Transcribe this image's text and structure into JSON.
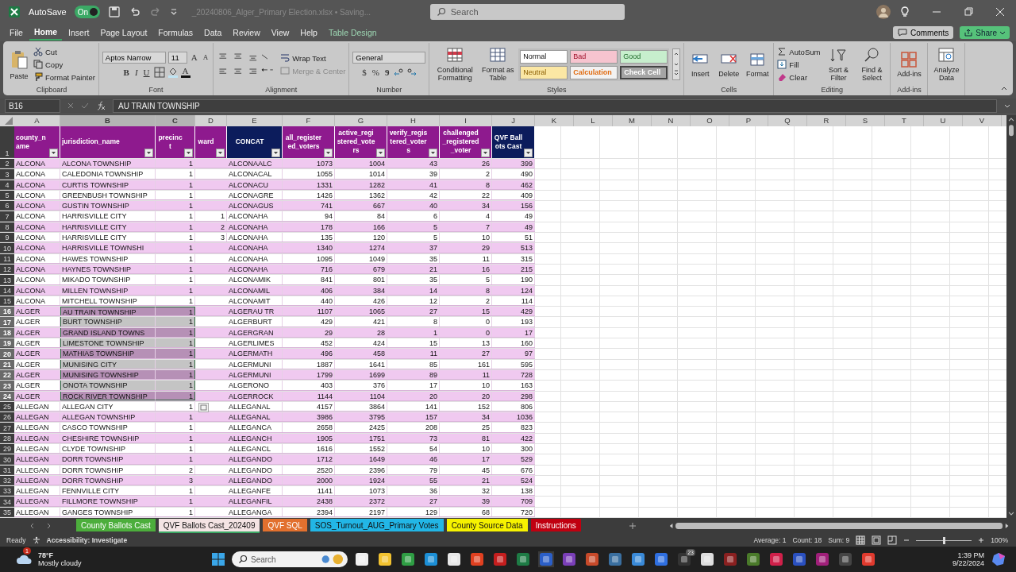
{
  "title_bar": {
    "autosave_label": "AutoSave",
    "autosave_toggle": {
      "label": "On",
      "on": true
    },
    "filename": "_20240806_Alger_Primary Election.xlsx • Saving...",
    "search_placeholder": "Search"
  },
  "menu_tabs": [
    {
      "label": "File",
      "selected": false,
      "kind": "standard"
    },
    {
      "label": "Home",
      "selected": true,
      "kind": "standard"
    },
    {
      "label": "Insert",
      "selected": false,
      "kind": "standard"
    },
    {
      "label": "Page Layout",
      "selected": false,
      "kind": "standard"
    },
    {
      "label": "Formulas",
      "selected": false,
      "kind": "standard"
    },
    {
      "label": "Data",
      "selected": false,
      "kind": "standard"
    },
    {
      "label": "Review",
      "selected": false,
      "kind": "standard"
    },
    {
      "label": "View",
      "selected": false,
      "kind": "standard"
    },
    {
      "label": "Help",
      "selected": false,
      "kind": "standard"
    },
    {
      "label": "Table Design",
      "selected": false,
      "kind": "contextual"
    }
  ],
  "comments_button": "Comments",
  "share_button": "Share",
  "ribbon": {
    "clipboard": {
      "label": "Clipboard",
      "paste": "Paste",
      "cut": "Cut",
      "copy": "Copy",
      "format_painter": "Format Painter"
    },
    "font": {
      "label": "Font",
      "font_name": "Aptos Narrow",
      "font_size": "11",
      "grow": "A",
      "shrink": "A",
      "bold": "B",
      "italic": "I",
      "underline": "U",
      "font_color": "A"
    },
    "alignment": {
      "label": "Alignment",
      "wrap_text": "Wrap Text",
      "merge_center": {
        "label": "Merge & Center",
        "disabled": true
      }
    },
    "number": {
      "label": "Number",
      "format": "General",
      "currency": "$",
      "percent": "%",
      "comma": "9"
    },
    "styles": {
      "label": "Styles",
      "conditional_formatting": "Conditional Formatting",
      "format_as_table": "Format as Table",
      "cell_styles": [
        {
          "label": "Normal",
          "kind": "normal"
        },
        {
          "label": "Bad",
          "kind": "bad"
        },
        {
          "label": "Good",
          "kind": "good"
        },
        {
          "label": "Neutral",
          "kind": "neutral"
        },
        {
          "label": "Calculation",
          "kind": "calculation"
        },
        {
          "label": "Check Cell",
          "kind": "check"
        }
      ]
    },
    "cells": {
      "label": "Cells",
      "insert": "Insert",
      "delete": "Delete",
      "format": "Format"
    },
    "editing": {
      "label": "Editing",
      "autosum": "AutoSum",
      "fill": "Fill",
      "clear": "Clear",
      "sort_filter": "Sort & Filter",
      "find_select": "Find & Select"
    },
    "addins": {
      "label": "Add-ins",
      "addins": "Add-ins"
    },
    "analyze_data": "Analyze Data"
  },
  "formula_bar": {
    "name_box": "B16",
    "formula": "AU TRAIN TOWNSHIP"
  },
  "column_letters": [
    {
      "label": "A",
      "selected": false
    },
    {
      "label": "B",
      "selected": true
    },
    {
      "label": "C",
      "selected": true
    },
    {
      "label": "D",
      "selected": false
    },
    {
      "label": "E",
      "selected": false
    },
    {
      "label": "F",
      "selected": false
    },
    {
      "label": "G",
      "selected": false
    },
    {
      "label": "H",
      "selected": false
    },
    {
      "label": "I",
      "selected": false
    },
    {
      "label": "J",
      "selected": false
    },
    {
      "label": "K",
      "selected": false
    },
    {
      "label": "L",
      "selected": false
    },
    {
      "label": "M",
      "selected": false
    },
    {
      "label": "N",
      "selected": false
    },
    {
      "label": "O",
      "selected": false
    },
    {
      "label": "P",
      "selected": false
    },
    {
      "label": "Q",
      "selected": false
    },
    {
      "label": "R",
      "selected": false
    },
    {
      "label": "S",
      "selected": false
    },
    {
      "label": "T",
      "selected": false
    },
    {
      "label": "U",
      "selected": false
    },
    {
      "label": "V",
      "selected": false
    }
  ],
  "table": {
    "header_row_number": "1",
    "columns": [
      {
        "label": "county_name",
        "color": "#8e1a8e"
      },
      {
        "label": "jurisdiction_name",
        "color": "#8e1a8e"
      },
      {
        "label": "precinct",
        "color": "#8e1a8e"
      },
      {
        "label": "ward",
        "color": "#8e1a8e"
      },
      {
        "label": "CONCAT",
        "color": "#0c1c5c"
      },
      {
        "label": "all_registered_voters",
        "color": "#8e1a8e"
      },
      {
        "label": "active_registered_voters",
        "color": "#8e1a8e"
      },
      {
        "label": "verify_registered_voters",
        "color": "#8e1a8e"
      },
      {
        "label": "challenged_registered_voter",
        "color": "#8e1a8e"
      },
      {
        "label": "QVF Ballots Cast",
        "color": "#0c1c5c"
      }
    ],
    "rows": [
      {
        "n": "2",
        "selected": false,
        "cells": [
          "ALCONA",
          "ALCONA TOWNSHIP",
          "1",
          null,
          "ALCONAALC",
          "1073",
          "1004",
          "43",
          "26",
          "399"
        ]
      },
      {
        "n": "3",
        "selected": false,
        "cells": [
          "ALCONA",
          "CALEDONIA TOWNSHIP",
          "1",
          null,
          "ALCONACAL",
          "1055",
          "1014",
          "39",
          "2",
          "490"
        ]
      },
      {
        "n": "4",
        "selected": false,
        "cells": [
          "ALCONA",
          "CURTIS TOWNSHIP",
          "1",
          null,
          "ALCONACU",
          "1331",
          "1282",
          "41",
          "8",
          "462"
        ]
      },
      {
        "n": "5",
        "selected": false,
        "cells": [
          "ALCONA",
          "GREENBUSH TOWNSHIP",
          "1",
          null,
          "ALCONAGRE",
          "1426",
          "1362",
          "42",
          "22",
          "409"
        ]
      },
      {
        "n": "6",
        "selected": false,
        "cells": [
          "ALCONA",
          "GUSTIN TOWNSHIP",
          "1",
          null,
          "ALCONAGUS",
          "741",
          "667",
          "40",
          "34",
          "156"
        ]
      },
      {
        "n": "7",
        "selected": false,
        "cells": [
          "ALCONA",
          "HARRISVILLE CITY",
          "1",
          "1",
          "ALCONAHA",
          "94",
          "84",
          "6",
          "4",
          "49"
        ]
      },
      {
        "n": "8",
        "selected": false,
        "cells": [
          "ALCONA",
          "HARRISVILLE CITY",
          "1",
          "2",
          "ALCONAHA",
          "178",
          "166",
          "5",
          "7",
          "49"
        ]
      },
      {
        "n": "9",
        "selected": false,
        "cells": [
          "ALCONA",
          "HARRISVILLE CITY",
          "1",
          "3",
          "ALCONAHA",
          "135",
          "120",
          "5",
          "10",
          "51"
        ]
      },
      {
        "n": "10",
        "selected": false,
        "cells": [
          "ALCONA",
          "HARRISVILLE TOWNSHI",
          "1",
          null,
          "ALCONAHA",
          "1340",
          "1274",
          "37",
          "29",
          "513"
        ]
      },
      {
        "n": "11",
        "selected": false,
        "cells": [
          "ALCONA",
          "HAWES TOWNSHIP",
          "1",
          null,
          "ALCONAHA",
          "1095",
          "1049",
          "35",
          "11",
          "315"
        ]
      },
      {
        "n": "12",
        "selected": false,
        "cells": [
          "ALCONA",
          "HAYNES TOWNSHIP",
          "1",
          null,
          "ALCONAHA",
          "716",
          "679",
          "21",
          "16",
          "215"
        ]
      },
      {
        "n": "13",
        "selected": false,
        "cells": [
          "ALCONA",
          "MIKADO TOWNSHIP",
          "1",
          null,
          "ALCONAMIK",
          "841",
          "801",
          "35",
          "5",
          "190"
        ]
      },
      {
        "n": "14",
        "selected": false,
        "cells": [
          "ALCONA",
          "MILLEN TOWNSHIP",
          "1",
          null,
          "ALCONAMIL",
          "406",
          "384",
          "14",
          "8",
          "124"
        ]
      },
      {
        "n": "15",
        "selected": false,
        "cells": [
          "ALCONA",
          "MITCHELL TOWNSHIP",
          "1",
          null,
          "ALCONAMIT",
          "440",
          "426",
          "12",
          "2",
          "114"
        ]
      },
      {
        "n": "16",
        "selected": true,
        "cells": [
          "ALGER",
          "AU TRAIN TOWNSHIP",
          "1",
          null,
          "ALGERAU TR",
          "1107",
          "1065",
          "27",
          "15",
          "429"
        ]
      },
      {
        "n": "17",
        "selected": true,
        "cells": [
          "ALGER",
          "BURT TOWNSHIP",
          "1",
          null,
          "ALGERBURT",
          "429",
          "421",
          "8",
          "0",
          "193"
        ]
      },
      {
        "n": "18",
        "selected": true,
        "cells": [
          "ALGER",
          "GRAND ISLAND TOWNS",
          "1",
          null,
          "ALGERGRAN",
          "29",
          "28",
          "1",
          "0",
          "17"
        ]
      },
      {
        "n": "19",
        "selected": true,
        "cells": [
          "ALGER",
          "LIMESTONE TOWNSHIP",
          "1",
          null,
          "ALGERLIMES",
          "452",
          "424",
          "15",
          "13",
          "160"
        ]
      },
      {
        "n": "20",
        "selected": true,
        "cells": [
          "ALGER",
          "MATHIAS TOWNSHIP",
          "1",
          null,
          "ALGERMATH",
          "496",
          "458",
          "11",
          "27",
          "97"
        ]
      },
      {
        "n": "21",
        "selected": true,
        "cells": [
          "ALGER",
          "MUNISING CITY",
          "1",
          null,
          "ALGERMUNI",
          "1887",
          "1641",
          "85",
          "161",
          "595"
        ]
      },
      {
        "n": "22",
        "selected": true,
        "cells": [
          "ALGER",
          "MUNISING TOWNSHIP",
          "1",
          null,
          "ALGERMUNI",
          "1799",
          "1699",
          "89",
          "11",
          "728"
        ]
      },
      {
        "n": "23",
        "selected": true,
        "cells": [
          "ALGER",
          "ONOTA TOWNSHIP",
          "1",
          null,
          "ALGERONO",
          "403",
          "376",
          "17",
          "10",
          "163"
        ]
      },
      {
        "n": "24",
        "selected": true,
        "cells": [
          "ALGER",
          "ROCK RIVER TOWNSHIP",
          "1",
          null,
          "ALGERROCK",
          "1144",
          "1104",
          "20",
          "20",
          "298"
        ]
      },
      {
        "n": "25",
        "selected": false,
        "cells": [
          "ALLEGAN",
          "ALLEGAN CITY",
          "1",
          null,
          "ALLEGANAL",
          "4157",
          "3864",
          "141",
          "152",
          "806"
        ]
      },
      {
        "n": "26",
        "selected": false,
        "cells": [
          "ALLEGAN",
          "ALLEGAN TOWNSHIP",
          "1",
          null,
          "ALLEGANAL",
          "3986",
          "3795",
          "157",
          "34",
          "1036"
        ]
      },
      {
        "n": "27",
        "selected": false,
        "cells": [
          "ALLEGAN",
          "CASCO TOWNSHIP",
          "1",
          null,
          "ALLEGANCA",
          "2658",
          "2425",
          "208",
          "25",
          "823"
        ]
      },
      {
        "n": "28",
        "selected": false,
        "cells": [
          "ALLEGAN",
          "CHESHIRE TOWNSHIP",
          "1",
          null,
          "ALLEGANCH",
          "1905",
          "1751",
          "73",
          "81",
          "422"
        ]
      },
      {
        "n": "29",
        "selected": false,
        "cells": [
          "ALLEGAN",
          "CLYDE TOWNSHIP",
          "1",
          null,
          "ALLEGANCL",
          "1616",
          "1552",
          "54",
          "10",
          "300"
        ]
      },
      {
        "n": "30",
        "selected": false,
        "cells": [
          "ALLEGAN",
          "DORR TOWNSHIP",
          "1",
          null,
          "ALLEGANDO",
          "1712",
          "1649",
          "46",
          "17",
          "529"
        ]
      },
      {
        "n": "31",
        "selected": false,
        "cells": [
          "ALLEGAN",
          "DORR TOWNSHIP",
          "2",
          null,
          "ALLEGANDO",
          "2520",
          "2396",
          "79",
          "45",
          "676"
        ]
      },
      {
        "n": "32",
        "selected": false,
        "cells": [
          "ALLEGAN",
          "DORR TOWNSHIP",
          "3",
          null,
          "ALLEGANDO",
          "2000",
          "1924",
          "55",
          "21",
          "524"
        ]
      },
      {
        "n": "33",
        "selected": false,
        "cells": [
          "ALLEGAN",
          "FENNVILLE CITY",
          "1",
          null,
          "ALLEGANFE",
          "1141",
          "1073",
          "36",
          "32",
          "138"
        ]
      },
      {
        "n": "34",
        "selected": false,
        "cells": [
          "ALLEGAN",
          "FILLMORE TOWNSHIP",
          "1",
          null,
          "ALLEGANFIL",
          "2438",
          "2372",
          "27",
          "39",
          "709"
        ]
      },
      {
        "n": "35",
        "selected": false,
        "cells": [
          "ALLEGAN",
          "GANGES TOWNSHIP",
          "1",
          null,
          "ALLEGANGA",
          "2394",
          "2197",
          "129",
          "68",
          "720"
        ]
      }
    ]
  },
  "sheet_tabs": [
    {
      "label": "County Ballots Cast",
      "color": "#4cae3c",
      "selected": false
    },
    {
      "label": "QVF Ballots Cast_202409",
      "color": "#f4e4e4",
      "selected": true
    },
    {
      "label": "QVF SQL",
      "color": "#e2702e",
      "selected": false
    },
    {
      "label": "SOS_Turnout_AUG_Primary Votes",
      "color": "#22b6e6",
      "selected": false
    },
    {
      "label": "County Source Data",
      "color": "#f6f200",
      "selected": false
    },
    {
      "label": "Instructions",
      "color": "#c00010",
      "selected": false
    }
  ],
  "status_bar": {
    "ready": "Ready",
    "accessibility": "Accessibility: Investigate",
    "average": "Average: 1",
    "count": "Count: 18",
    "sum": "Sum: 9",
    "zoom": {
      "level": 0.5
    },
    "zoom_percent": "100%"
  },
  "taskbar": {
    "weather_badge": "1",
    "temperature": "78°F",
    "weather": "Mostly cloudy",
    "search_placeholder": "Search",
    "app_badge": "23",
    "time": "1:39 PM",
    "date": "9/22/2024"
  }
}
